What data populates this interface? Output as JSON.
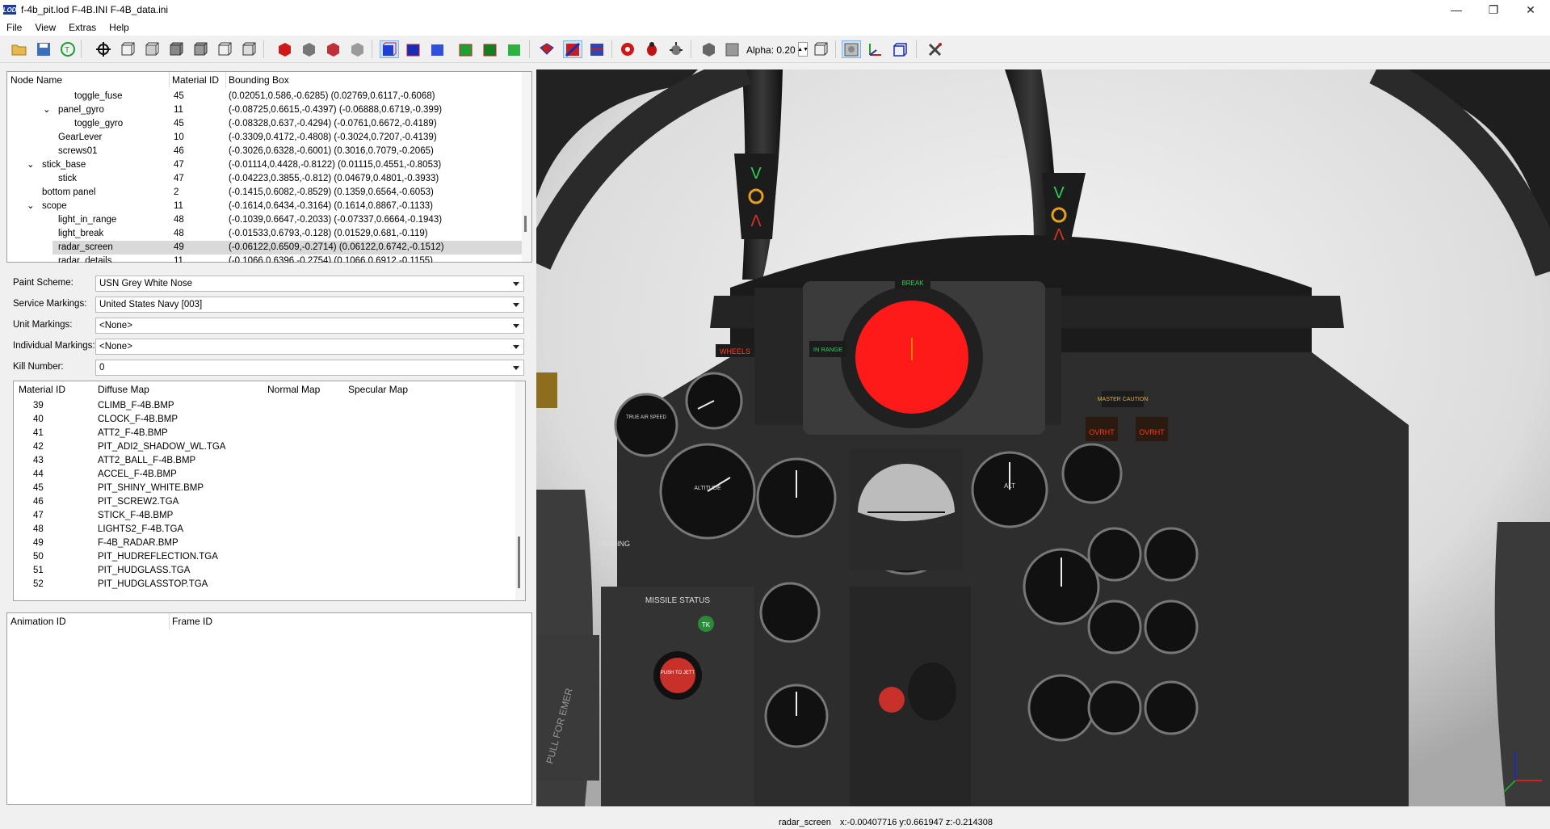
{
  "window": {
    "title": "f-4b_pit.lod  F-4B.INI  F-4B_data.ini",
    "app_icon_text": "LOD",
    "minimize": "—",
    "maximize": "❐",
    "close": "✕"
  },
  "menu": [
    "File",
    "View",
    "Extras",
    "Help"
  ],
  "toolbar": {
    "alpha_label": "Alpha: 0.20"
  },
  "node_tree": {
    "headers": [
      "Node Name",
      "Material ID",
      "Bounding Box"
    ],
    "rows": [
      {
        "name": "toggle_fuse",
        "mat": "45",
        "box": "(0.02051,0.586,-0.6285) (0.02769,0.6117,-0.6068)"
      },
      {
        "name": "panel_gyro",
        "mat": "11",
        "box": "(-0.08725,0.6615,-0.4397) (-0.06888,0.6719,-0.399)"
      },
      {
        "name": "toggle_gyro",
        "mat": "45",
        "box": "(-0.08328,0.637,-0.4294) (-0.0761,0.6672,-0.4189)"
      },
      {
        "name": "GearLever",
        "mat": "10",
        "box": "(-0.3309,0.4172,-0.4808) (-0.3024,0.7207,-0.4139)"
      },
      {
        "name": "screws01",
        "mat": "46",
        "box": "(-0.3026,0.6328,-0.6001) (0.3016,0.7079,-0.2065)"
      },
      {
        "name": "stick_base",
        "mat": "47",
        "box": "(-0.01114,0.4428,-0.8122) (0.01115,0.4551,-0.8053)"
      },
      {
        "name": "stick",
        "mat": "47",
        "box": "(-0.04223,0.3855,-0.812) (0.04679,0.4801,-0.3933)"
      },
      {
        "name": "bottom panel",
        "mat": "2",
        "box": "(-0.1415,0.6082,-0.8529) (0.1359,0.6564,-0.6053)"
      },
      {
        "name": "scope",
        "mat": "11",
        "box": "(-0.1614,0.6434,-0.3164) (0.1614,0.8867,-0.1133)"
      },
      {
        "name": "light_in_range",
        "mat": "48",
        "box": "(-0.1039,0.6647,-0.2033) (-0.07337,0.6664,-0.1943)"
      },
      {
        "name": "light_break",
        "mat": "48",
        "box": "(-0.01533,0.6793,-0.128) (0.01529,0.681,-0.119)"
      },
      {
        "name": "radar_screen",
        "mat": "49",
        "box": "(-0.06122,0.6509,-0.2714) (0.06122,0.6742,-0.1512)"
      },
      {
        "name": "radar_details",
        "mat": "11",
        "box": "(-0.1066,0.6396,-0.2754) (0.1066,0.6912,-0.1155)"
      }
    ]
  },
  "markings": {
    "paint_scheme": {
      "label": "Paint Scheme:",
      "value": "USN Grey White Nose"
    },
    "service": {
      "label": "Service Markings:",
      "value": "United States Navy [003]"
    },
    "unit": {
      "label": "Unit Markings:",
      "value": "<None>"
    },
    "individual": {
      "label": "Individual Markings:",
      "value": "<None>"
    },
    "kill": {
      "label": "Kill Number:",
      "value": "0"
    }
  },
  "materials": {
    "headers": [
      "Material ID",
      "Diffuse Map",
      "Normal Map",
      "Specular Map"
    ],
    "rows": [
      {
        "id": "39",
        "diffuse": "CLIMB_F-4B.BMP"
      },
      {
        "id": "40",
        "diffuse": "CLOCK_F-4B.BMP"
      },
      {
        "id": "41",
        "diffuse": "ATT2_F-4B.BMP"
      },
      {
        "id": "42",
        "diffuse": "PIT_ADI2_SHADOW_WL.TGA"
      },
      {
        "id": "43",
        "diffuse": "ATT2_BALL_F-4B.BMP"
      },
      {
        "id": "44",
        "diffuse": "ACCEL_F-4B.BMP"
      },
      {
        "id": "45",
        "diffuse": "PIT_SHINY_WHITE.BMP"
      },
      {
        "id": "46",
        "diffuse": "PIT_SCREW2.TGA"
      },
      {
        "id": "47",
        "diffuse": "STICK_F-4B.BMP"
      },
      {
        "id": "48",
        "diffuse": "LIGHTS2_F-4B.TGA"
      },
      {
        "id": "49",
        "diffuse": "F-4B_RADAR.BMP"
      },
      {
        "id": "50",
        "diffuse": "PIT_HUDREFLECTION.TGA"
      },
      {
        "id": "51",
        "diffuse": "PIT_HUDGLASS.TGA"
      },
      {
        "id": "52",
        "diffuse": "PIT_HUDGLASSTOP.TGA"
      }
    ]
  },
  "animation": {
    "headers": [
      "Animation ID",
      "Frame ID"
    ]
  },
  "cockpit_labels": {
    "wheels": "WHEELS",
    "break": "BREAK",
    "in_range": "IN RANGE",
    "missile_status": "MISSILE STATUS",
    "master_caution": "MASTER CAUTION",
    "ovrht": "OVRHT",
    "altitude": "ALTITUDE",
    "pull_for_emer": "PULL FOR EMER",
    "true_air_speed": "TRUE AIR SPEED",
    "landing": "LANDING",
    "push_to_jett": "PUSH TO JETT",
    "alt": "ALT",
    "tk": "TK"
  },
  "status": {
    "node": "radar_screen",
    "coords": "x:-0.00407716 y:0.661947 z:-0.214308"
  },
  "colors": {
    "radar": "#ff1a1a",
    "panel": "#3a3a3a",
    "accent_green": "#2bd15b",
    "warn_red": "#e03020"
  }
}
